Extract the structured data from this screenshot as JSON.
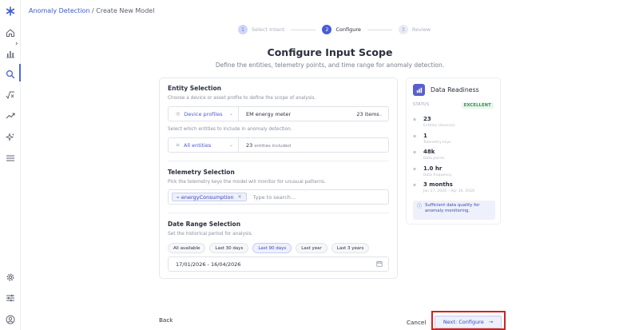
{
  "breadcrumb": {
    "link": "Anomaly Detection",
    "separator": " / ",
    "current": "Create New Model"
  },
  "stepper": [
    {
      "num": "1",
      "label": "Select Intent"
    },
    {
      "num": "2",
      "label": "Configure"
    },
    {
      "num": "3",
      "label": "Review"
    }
  ],
  "page": {
    "title": "Configure Input Scope",
    "subtitle": "Define the entities, telemetry points, and time range for anomaly detection."
  },
  "entity": {
    "title": "Entity Selection",
    "desc": "Choose a device or asset profile to define the scope of analysis.",
    "profile_type": "Device profiles",
    "profile_value": "EM energy meter",
    "profile_count": "23 items",
    "include_desc": "Select which entities to include in anomaly detection.",
    "include_option": "All entities",
    "included_count": "23",
    "included_suffix": "entities included"
  },
  "telemetry": {
    "title": "Telemetry Selection",
    "desc": "Pick the telemetry keys the model will monitor for unusual patterns.",
    "chip": "energyConsumption",
    "search_placeholder": "Type to search..."
  },
  "date_range": {
    "title": "Date Range Selection",
    "desc": "Set the historical period for analysis.",
    "presets": [
      "All available",
      "Last 30 days",
      "Last 90 days",
      "Last year",
      "Last 3 years"
    ],
    "active_preset": "Last 90 days",
    "value": "17/01/2026 - 16/04/2026"
  },
  "readiness": {
    "title": "Data Readiness",
    "status_label": "STATUS",
    "status_value": "EXCELLENT",
    "stats": [
      {
        "value": "23",
        "label": "Entities (devices)"
      },
      {
        "value": "1",
        "label": "Telemetry keys"
      },
      {
        "value": "48k",
        "label": "Data points"
      },
      {
        "value": "1.0 hr",
        "label": "Data frequency"
      },
      {
        "value": "3 months",
        "label": "Jan 17, 2026 – Apr 16, 2026"
      }
    ],
    "note": "Sufficient data quality for anomaly monitoring."
  },
  "footer": {
    "back": "Back",
    "cancel": "Cancel",
    "next": "Next: Configure"
  }
}
